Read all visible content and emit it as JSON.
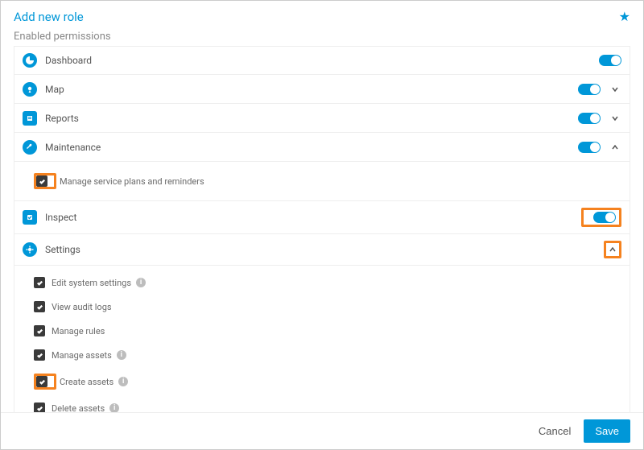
{
  "header": {
    "title": "Add new role"
  },
  "subheader": "Enabled permissions",
  "sections": {
    "dashboard": {
      "label": "Dashboard"
    },
    "map": {
      "label": "Map"
    },
    "reports": {
      "label": "Reports"
    },
    "maintenance": {
      "label": "Maintenance",
      "children": {
        "service_plans": {
          "label": "Manage service plans and reminders"
        }
      }
    },
    "inspect": {
      "label": "Inspect"
    },
    "settings": {
      "label": "Settings",
      "children": {
        "edit_system": {
          "label": "Edit system settings"
        },
        "audit_logs": {
          "label": "View audit logs"
        },
        "manage_rules": {
          "label": "Manage rules"
        },
        "manage_assets": {
          "label": "Manage assets"
        },
        "create_assets": {
          "label": "Create assets"
        },
        "delete_assets": {
          "label": "Delete assets"
        }
      }
    }
  },
  "footer": {
    "cancel": "Cancel",
    "save": "Save"
  }
}
